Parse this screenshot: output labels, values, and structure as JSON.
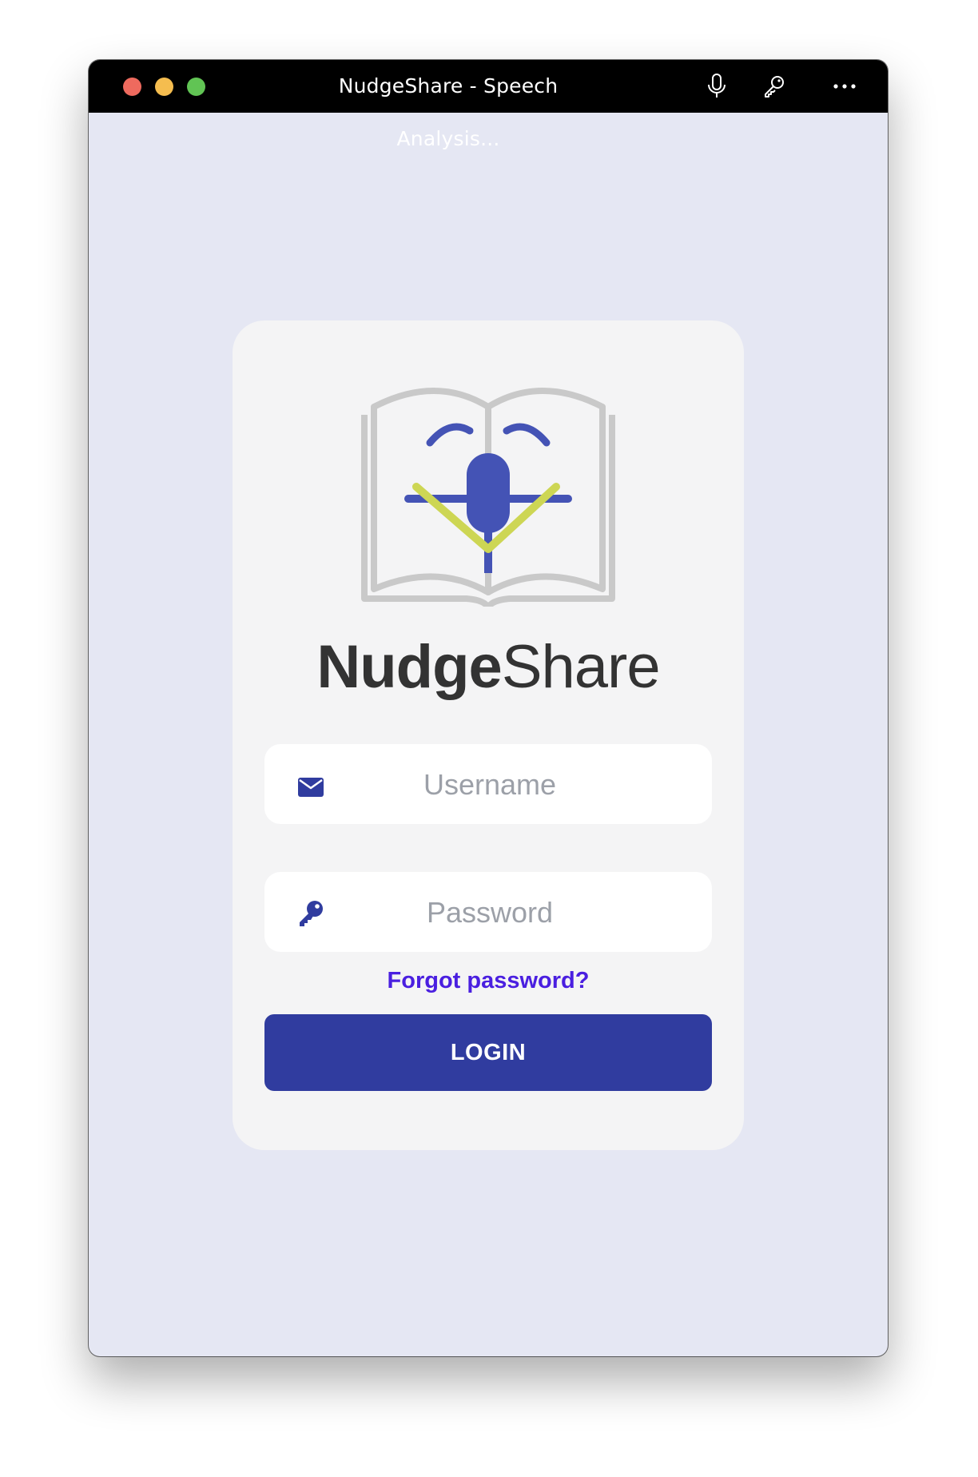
{
  "window": {
    "title": "NudgeShare - Speech Analysis...",
    "toolbar_icons": [
      "microphone-icon",
      "key-icon",
      "more-icon"
    ]
  },
  "brand": {
    "name_bold": "Nudge",
    "name_light": "Share",
    "logo": "book-microphone-logo"
  },
  "form": {
    "username_placeholder": "Username",
    "username_value": "",
    "username_icon": "envelope-icon",
    "password_placeholder": "Password",
    "password_value": "",
    "password_icon": "key-icon",
    "forgot_label": "Forgot password?",
    "login_label": "LOGIN"
  },
  "colors": {
    "background": "#e5e7f3",
    "card": "#f4f4f5",
    "accent": "#303c9f",
    "link": "#4a1fe0",
    "logo_blue": "#4453b5",
    "logo_green": "#cdd654"
  }
}
